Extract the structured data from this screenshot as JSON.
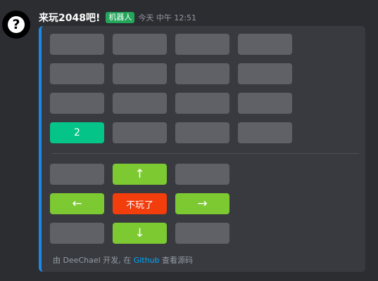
{
  "message": {
    "username": "来玩2048吧!",
    "badge": "机器人",
    "timestamp": "今天 中午 12:51",
    "avatar_icon": "question-mark-icon",
    "avatar_symbol": "?"
  },
  "board": {
    "rows": [
      [
        "",
        "",
        "",
        ""
      ],
      [
        "",
        "",
        "",
        ""
      ],
      [
        "",
        "",
        "",
        ""
      ],
      [
        "2",
        "",
        "",
        ""
      ]
    ]
  },
  "controls": {
    "up": "↑",
    "left": "←",
    "quit": "不玩了",
    "right": "→",
    "down": "↓"
  },
  "footer": {
    "prefix": "由 DeeChael 开发, 在 ",
    "link": "Github",
    "suffix": " 查看源码"
  },
  "colors": {
    "background": "#2b2d31",
    "embed": "#393a3f",
    "accent_bar": "#1e88e5",
    "empty_cell": "#5f6166",
    "tile_2": "#05c487",
    "arrow_button": "#7cc932",
    "quit_button": "#f23d0d",
    "badge": "#23a55a",
    "link": "#00a8fc"
  }
}
